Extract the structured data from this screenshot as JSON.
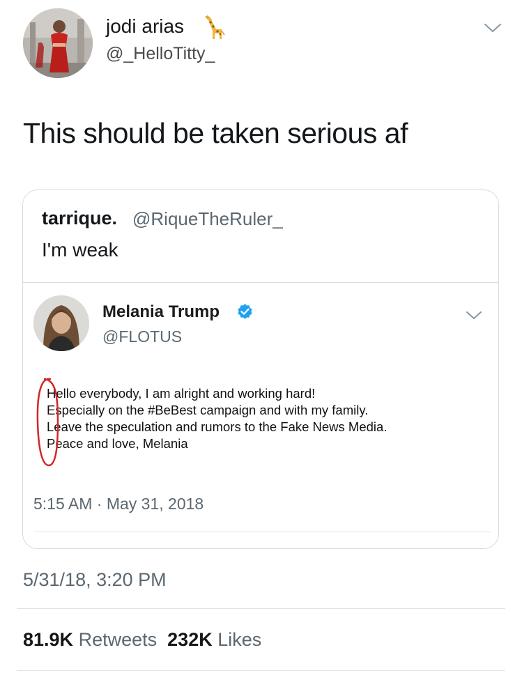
{
  "author": {
    "display_name": "jodi arias",
    "name_emoji": "giraffe",
    "handle": "@_HelloTitty_"
  },
  "tweet": {
    "text": "This should be taken serious af",
    "timestamp": "5/31/18, 3:20 PM",
    "retweets_count": "81.9K",
    "retweets_label": "Retweets",
    "likes_count": "232K",
    "likes_label": "Likes"
  },
  "quoted_tweet": {
    "author_name": "tarrique.",
    "author_handle": "@RiqueTheRuler_",
    "text": "I'm weak"
  },
  "embedded_screenshot": {
    "name": "Melania Trump",
    "handle": "@FLOTUS",
    "verified": true,
    "lines": [
      "Hello everybody, I am alright and working hard!",
      "Especially on the #BeBest campaign and with my family.",
      "Leave the speculation and rumors to the Fake News Media.",
      "Peace and love, Melania"
    ],
    "time": "5:15 AM · May 31, 2018"
  },
  "colors": {
    "text_primary": "#14171a",
    "text_secondary": "#5b6770",
    "verified_blue": "#1da1f2",
    "annotation_red": "#d1262b",
    "border": "#d6dbe0"
  },
  "icons": [
    "chevron-down-icon",
    "verified-badge-icon",
    "giraffe-emoji-icon"
  ]
}
